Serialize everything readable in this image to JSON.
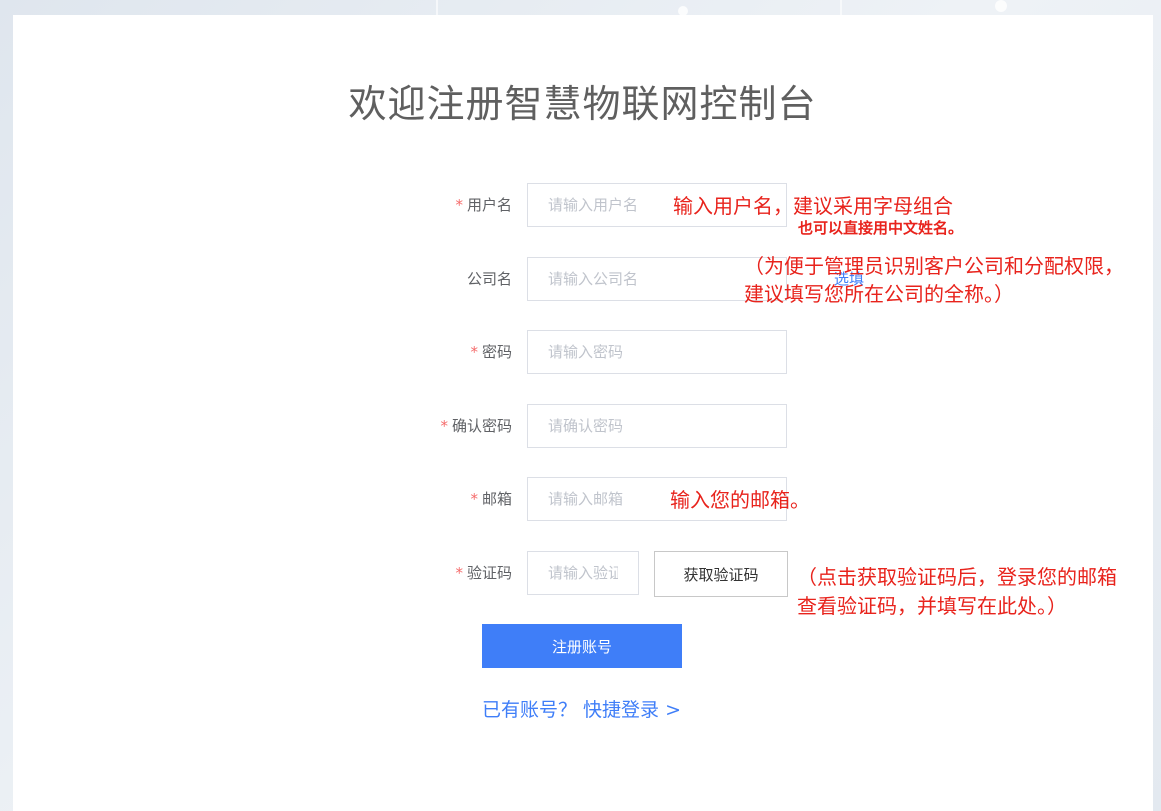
{
  "header": {
    "title": "欢迎注册智慧物联网控制台"
  },
  "form": {
    "username": {
      "label": "用户名",
      "required": true,
      "placeholder": "请输入用户名"
    },
    "company": {
      "label": "公司名",
      "required": false,
      "placeholder": "请输入公司名",
      "optional_tag": "选填"
    },
    "password": {
      "label": "密码",
      "required": true,
      "placeholder": "请输入密码"
    },
    "confirm_password": {
      "label": "确认密码",
      "required": true,
      "placeholder": "请确认密码"
    },
    "email": {
      "label": "邮箱",
      "required": true,
      "placeholder": "请输入邮箱"
    },
    "code": {
      "label": "验证码",
      "required": true,
      "placeholder": "请输入验证码",
      "get_code_button": "获取验证码"
    },
    "required_mark": "*",
    "submit_label": "注册账号",
    "login_link": "已有账号？ 快捷登录 >"
  },
  "annotations": {
    "username_line1": "输入用户名，建议采用字母组合",
    "username_line2": "也可以直接用中文姓名。",
    "company_line1": "（为便于管理员识别客户公司和分配权限，",
    "company_line2": "建议填写您所在公司的全称。）",
    "email": "输入您的邮箱。",
    "code_line1": "（点击获取验证码后，登录您的邮箱",
    "code_line2": "查看验证码，并填写在此处。）"
  },
  "colors": {
    "accent": "#3f7ef8",
    "required": "#f56c6c",
    "annotation": "#e8231c"
  }
}
